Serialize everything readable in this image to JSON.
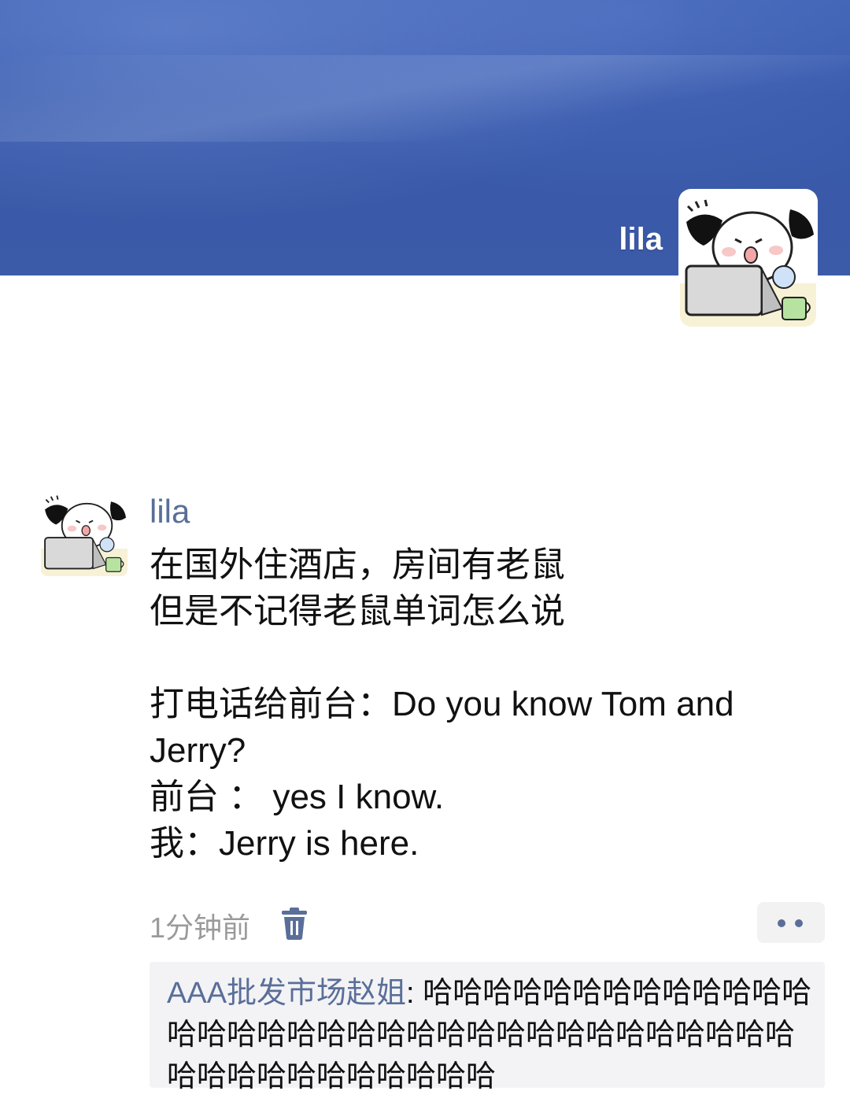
{
  "profile": {
    "name": "lila",
    "avatar_icon": "puppy-laptop-sticker-icon"
  },
  "post": {
    "author": "lila",
    "lines": [
      "在国外住酒店，房间有老鼠",
      "但是不记得老鼠单词怎么说",
      "",
      "打电话给前台：Do you know Tom and",
      "Jerry?",
      "前台 ： yes I know.",
      "我：Jerry is here."
    ],
    "time": "1分钟前",
    "delete_icon": "trash-icon",
    "more_icon": "more-dots-icon"
  },
  "comments": [
    {
      "commenter": "AAA批发市场赵姐",
      "separator": ": ",
      "text": "哈哈哈哈哈哈哈哈哈哈哈哈哈哈哈哈哈哈哈哈哈哈哈哈哈哈哈哈哈哈哈哈哈哈哈哈哈哈哈哈哈哈哈哈哈"
    }
  ],
  "colors": {
    "cover_blue": "#3456a8",
    "name_link": "#5a6e99",
    "time_gray": "#9a9a9a",
    "comment_bg": "#f3f3f5"
  }
}
